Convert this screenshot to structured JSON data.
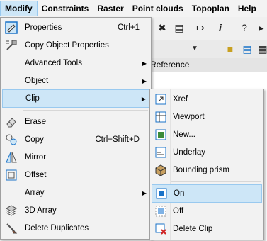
{
  "menubar": {
    "items": [
      {
        "label": "Modify",
        "active": true
      },
      {
        "label": "Constraints"
      },
      {
        "label": "Raster"
      },
      {
        "label": "Point clouds"
      },
      {
        "label": "Topoplan"
      },
      {
        "label": "Help"
      }
    ]
  },
  "background": {
    "tab_label": "Reference"
  },
  "modify_menu": {
    "items": [
      {
        "label": "Properties",
        "shortcut": "Ctrl+1",
        "icon": "properties-icon"
      },
      {
        "label": "Copy Object Properties",
        "icon": "match-properties-icon"
      },
      {
        "label": "Advanced Tools",
        "submenu": true
      },
      {
        "label": "Object",
        "submenu": true
      },
      {
        "label": "Clip",
        "submenu": true,
        "highlighted": true
      },
      {
        "label": "Erase",
        "icon": "eraser-icon"
      },
      {
        "label": "Copy",
        "shortcut": "Ctrl+Shift+D",
        "icon": "copy-icon"
      },
      {
        "label": "Mirror",
        "icon": "mirror-icon"
      },
      {
        "label": "Offset",
        "icon": "offset-icon"
      },
      {
        "label": "Array",
        "submenu": true
      },
      {
        "label": "3D Array",
        "icon": "3d-array-icon"
      },
      {
        "label": "Delete Duplicates",
        "icon": "delete-duplicates-icon"
      }
    ]
  },
  "clip_submenu": {
    "items": [
      {
        "label": "Xref",
        "icon": "xref-clip-icon"
      },
      {
        "label": "Viewport",
        "icon": "viewport-clip-icon"
      },
      {
        "label": "New...",
        "icon": "image-clip-icon"
      },
      {
        "label": "Underlay",
        "icon": "underlay-clip-icon"
      },
      {
        "label": "Bounding prism",
        "icon": "bounding-prism-icon"
      },
      {
        "label": "On",
        "icon": "clip-on-icon",
        "highlighted": true
      },
      {
        "label": "Off",
        "icon": "clip-off-icon"
      },
      {
        "label": "Delete Clip",
        "icon": "delete-clip-icon"
      }
    ]
  }
}
